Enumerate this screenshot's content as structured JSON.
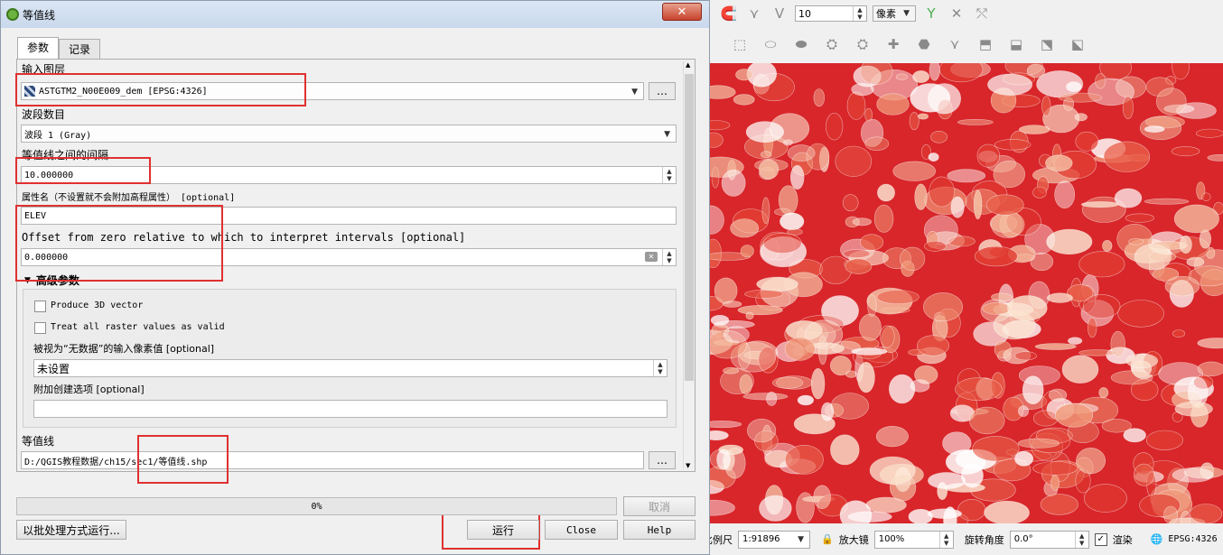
{
  "dialog": {
    "title": "等值线",
    "tabs": [
      "参数",
      "记录"
    ],
    "input_layer_label": "输入图层",
    "input_layer_value": "ASTGTM2_N00E009_dem [EPSG:4326]",
    "band_label": "波段数目",
    "band_value": "波段 1 (Gray)",
    "interval_label": "等值线之间的间隔",
    "interval_value": "10.000000",
    "attr_label": "属性名（不设置就不会附加高程属性） [optional]",
    "attr_value": "ELEV",
    "offset_label": "Offset from zero relative to which to interpret intervals [optional]",
    "offset_value": "0.000000",
    "advanced_label": "高级参数",
    "produce_3d_label": "Produce 3D vector",
    "treat_raster_label": "Treat all raster values as valid",
    "nodata_label": "被视为“无数据”的输入像素值 [optional]",
    "nodata_value": "未设置",
    "creation_options_label": "附加创建选项 [optional]",
    "creation_options_value": "",
    "output_label": "等值线",
    "output_value": "D:/QGIS教程数据/ch15/sec1/等值线.shp",
    "browse_label": "…",
    "progress_text": "0%",
    "progress_value": 0,
    "cancel_label": "取消",
    "batch_label": "以批处理方式运行...",
    "run_label": "运行",
    "close_label": "Close",
    "help_label": "Help"
  },
  "toolbar": {
    "tolerance_value": "10",
    "unit_value": "像素"
  },
  "statusbar": {
    "scale_label": "比例尺",
    "scale_value": "1:91896",
    "magnifier_label": "放大镜",
    "magnifier_value": "100%",
    "rotation_label": "旋转角度",
    "rotation_value": "0.0°",
    "render_label": "渲染",
    "crs_label": "EPSG:4326"
  },
  "colors": {
    "highlight": "#e03030",
    "map_base": "#d8262a"
  }
}
